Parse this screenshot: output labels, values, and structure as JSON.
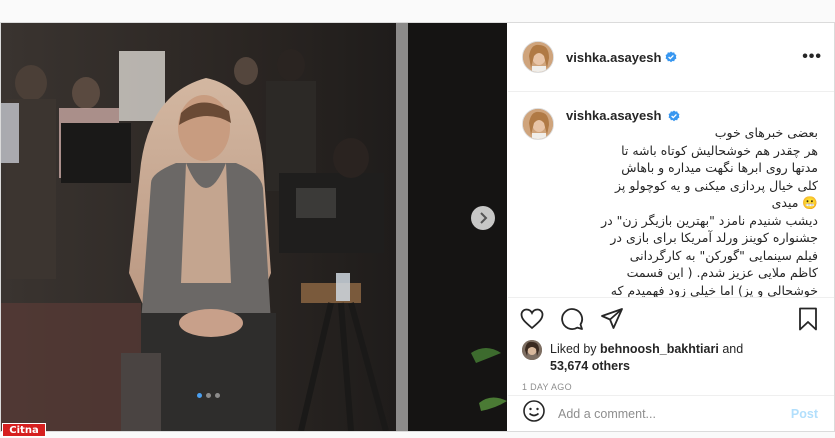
{
  "post": {
    "username": "vishka.asayesh",
    "verified_icon": "verified-badge-icon",
    "more_icon": "more-options-icon",
    "more_label": "•••",
    "caption_lines": [
      "بعضی خبرهای خوب",
      "هر چقدر هم خوشحالیش کوتاه باشه تا",
      "مدتها روی ابرها نگهت میداره و باهاش",
      "کلی خیال پردازی میکنی و یه کوچولو پز",
      "😬 میدی",
      "دیشب شنیدم نامزد \"بهترین بازیگر زن\" در",
      "جشنواره کوینز ورلد آمریکا برای بازی در",
      "فیلم سینمایی \"گورکن\" به کارگردانی",
      "کاظم ملایی عزیز شدم. ( این قسمت",
      "خوشحالی و پز) اما خیلی زود فهمیدم که"
    ],
    "likes": {
      "prefix": "Liked by",
      "user": "behnoosh_bakhtiari",
      "conjunction": "and",
      "count": "53,674 others"
    },
    "time": "1 DAY AGO",
    "carousel": {
      "slides": 3,
      "active": 1
    }
  },
  "actions": {
    "like_icon": "heart-icon",
    "comment_icon": "comment-icon",
    "share_icon": "share-icon",
    "save_icon": "bookmark-icon"
  },
  "comment": {
    "emoji_icon": "emoji-icon",
    "placeholder": "Add a comment...",
    "post_label": "Post"
  },
  "watermark": "Citna",
  "colors": {
    "verified": "#3897f0",
    "post_disabled": "#b2dffc",
    "watermark": "#d61f1f"
  }
}
